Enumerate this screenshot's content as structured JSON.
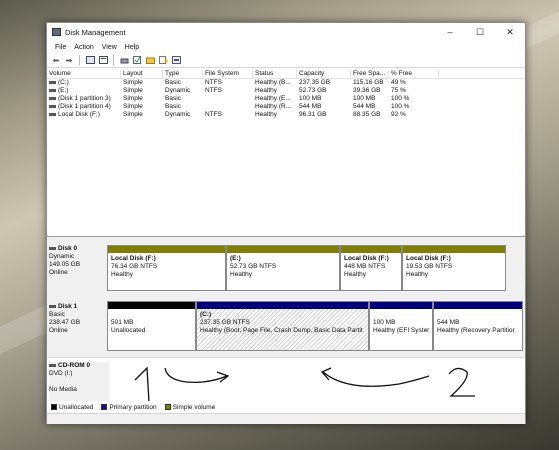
{
  "window": {
    "title": "Disk Management",
    "controls": {
      "minimize": "–",
      "maximize": "☐",
      "close": "✕"
    }
  },
  "menu": [
    "File",
    "Action",
    "View",
    "Help"
  ],
  "toolbar_icons": [
    "back-arrow-icon",
    "forward-arrow-icon",
    "console-icon",
    "help-icon",
    "properties-icon",
    "rescan-icon",
    "check-icon",
    "folder-icon",
    "wizard-icon",
    "settings-icon"
  ],
  "volume_table": {
    "headers": [
      "Volume",
      "Layout",
      "Type",
      "File System",
      "Status",
      "Capacity",
      "Free Spa...",
      "% Free"
    ],
    "rows": [
      [
        "(C:)",
        "Simple",
        "Basic",
        "NTFS",
        "Healthy (B...",
        "237.35 GB",
        "115.16 GB",
        "49 %"
      ],
      [
        "(E:)",
        "Simple",
        "Dynamic",
        "NTFS",
        "Healthy",
        "52.73 GB",
        "39.36 GB",
        "75 %"
      ],
      [
        "(Disk 1 partition 3)",
        "Simple",
        "Basic",
        "",
        "Healthy (E...",
        "100 MB",
        "100 MB",
        "100 %"
      ],
      [
        "(Disk 1 partition 4)",
        "Simple",
        "Basic",
        "",
        "Healthy (R...",
        "544 MB",
        "544 MB",
        "100 %"
      ],
      [
        "Local Disk (F:)",
        "Simple",
        "Dynamic",
        "NTFS",
        "Healthy",
        "96.31 GB",
        "88.35 GB",
        "92 %"
      ]
    ]
  },
  "disks": [
    {
      "name": "Disk 0",
      "info": [
        "Dynamic",
        "149.05 GB",
        "Online"
      ],
      "partitions": [
        {
          "title": "Local Disk (F:)",
          "size": "76.34 GB NTFS",
          "status": "Healthy"
        },
        {
          "title": "(E:)",
          "size": "52.73 GB NTFS",
          "status": "Healthy"
        },
        {
          "title": "Local Disk (F:)",
          "size": "448 MB NTFS",
          "status": "Healthy"
        },
        {
          "title": "Local Disk (F:)",
          "size": "19.53 GB NTFS",
          "status": "Healthy"
        }
      ]
    },
    {
      "name": "Disk 1",
      "info": [
        "Basic",
        "238.47 GB",
        "Online"
      ],
      "partitions": [
        {
          "title": "",
          "size": "501 MB",
          "status": "Unallocated"
        },
        {
          "title": "(C:)",
          "size": "237.35 GB NTFS",
          "status": "Healthy (Boot, Page File, Crash Dump, Basic Data Partit"
        },
        {
          "title": "",
          "size": "100 MB",
          "status": "Healthy (EFI Syster"
        },
        {
          "title": "",
          "size": "544 MB",
          "status": "Healthy (Recovery Partitior"
        }
      ]
    }
  ],
  "cdrom": {
    "name": "CD-ROM 0",
    "info": [
      "DVD (I:)",
      "",
      "No Media"
    ]
  },
  "annotations": {
    "one": "1",
    "two": "2"
  },
  "legend": [
    {
      "label": "Unallocated",
      "color": "#000000"
    },
    {
      "label": "Primary partition",
      "color": "#1010a0"
    },
    {
      "label": "Simple volume",
      "color": "#7f7f00"
    }
  ],
  "colors": {
    "simple_volume": "#808000",
    "primary": "#00007f",
    "unallocated": "#000000"
  }
}
